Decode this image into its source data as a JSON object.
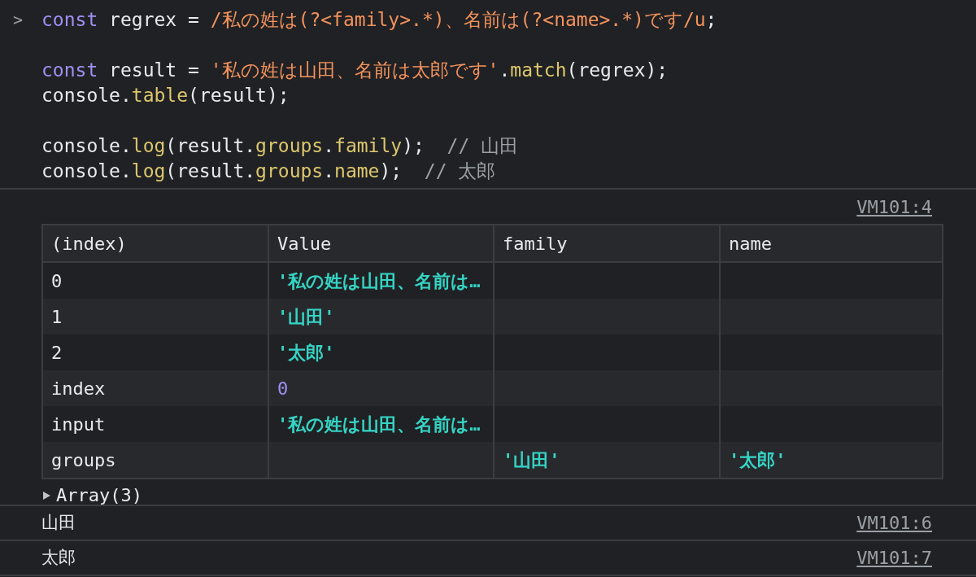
{
  "prompt": {
    "symbol": ">"
  },
  "code_blocks": [
    [
      [
        {
          "kind": "keyword",
          "text": "const"
        },
        {
          "kind": "plain",
          "text": " regrex = "
        },
        {
          "kind": "string",
          "text": "/私の姓は(?<family>.*)、名前は(?<name>.*)です/u"
        },
        {
          "kind": "plain",
          "text": ";"
        }
      ]
    ],
    [
      [
        {
          "kind": "keyword",
          "text": "const"
        },
        {
          "kind": "plain",
          "text": " result = "
        },
        {
          "kind": "string",
          "text": "'私の姓は山田、名前は太郎です'"
        },
        {
          "kind": "plain",
          "text": "."
        },
        {
          "kind": "method",
          "text": "match"
        },
        {
          "kind": "plain",
          "text": "(regrex);"
        }
      ],
      [
        {
          "kind": "plain",
          "text": "console."
        },
        {
          "kind": "method",
          "text": "table"
        },
        {
          "kind": "plain",
          "text": "(result);"
        }
      ]
    ],
    [
      [
        {
          "kind": "plain",
          "text": "console."
        },
        {
          "kind": "method",
          "text": "log"
        },
        {
          "kind": "plain",
          "text": "(result."
        },
        {
          "kind": "method",
          "text": "groups"
        },
        {
          "kind": "plain",
          "text": "."
        },
        {
          "kind": "method",
          "text": "family"
        },
        {
          "kind": "plain",
          "text": ");  "
        },
        {
          "kind": "comment",
          "text": "// 山田"
        }
      ],
      [
        {
          "kind": "plain",
          "text": "console."
        },
        {
          "kind": "method",
          "text": "log"
        },
        {
          "kind": "plain",
          "text": "(result."
        },
        {
          "kind": "method",
          "text": "groups"
        },
        {
          "kind": "plain",
          "text": "."
        },
        {
          "kind": "method",
          "text": "name"
        },
        {
          "kind": "plain",
          "text": ");  "
        },
        {
          "kind": "comment",
          "text": "// 太郎"
        }
      ]
    ]
  ],
  "table_message": {
    "source": "VM101:4",
    "columns": [
      "(index)",
      "Value",
      "family",
      "name"
    ],
    "rows": [
      {
        "cells": [
          {
            "kind": "plain",
            "text": "0"
          },
          {
            "kind": "string",
            "text": "'私の姓は山田、名前は…"
          },
          {
            "kind": "empty"
          },
          {
            "kind": "empty"
          }
        ]
      },
      {
        "cells": [
          {
            "kind": "plain",
            "text": "1"
          },
          {
            "kind": "string",
            "text": "'山田'"
          },
          {
            "kind": "empty"
          },
          {
            "kind": "empty"
          }
        ]
      },
      {
        "cells": [
          {
            "kind": "plain",
            "text": "2"
          },
          {
            "kind": "string",
            "text": "'太郎'"
          },
          {
            "kind": "empty"
          },
          {
            "kind": "empty"
          }
        ]
      },
      {
        "cells": [
          {
            "kind": "plain",
            "text": "index"
          },
          {
            "kind": "number",
            "text": "0"
          },
          {
            "kind": "empty"
          },
          {
            "kind": "empty"
          }
        ]
      },
      {
        "cells": [
          {
            "kind": "plain",
            "text": "input"
          },
          {
            "kind": "string",
            "text": "'私の姓は山田、名前は…"
          },
          {
            "kind": "empty"
          },
          {
            "kind": "empty"
          }
        ]
      },
      {
        "cells": [
          {
            "kind": "plain",
            "text": "groups"
          },
          {
            "kind": "empty"
          },
          {
            "kind": "string",
            "text": "'山田'"
          },
          {
            "kind": "string",
            "text": "'太郎'"
          }
        ]
      }
    ],
    "summary": {
      "text": "Array(3)",
      "expanded": false
    }
  },
  "log_messages": [
    {
      "text": "山田",
      "source": "VM101:6"
    },
    {
      "text": "太郎",
      "source": "VM101:7"
    }
  ]
}
